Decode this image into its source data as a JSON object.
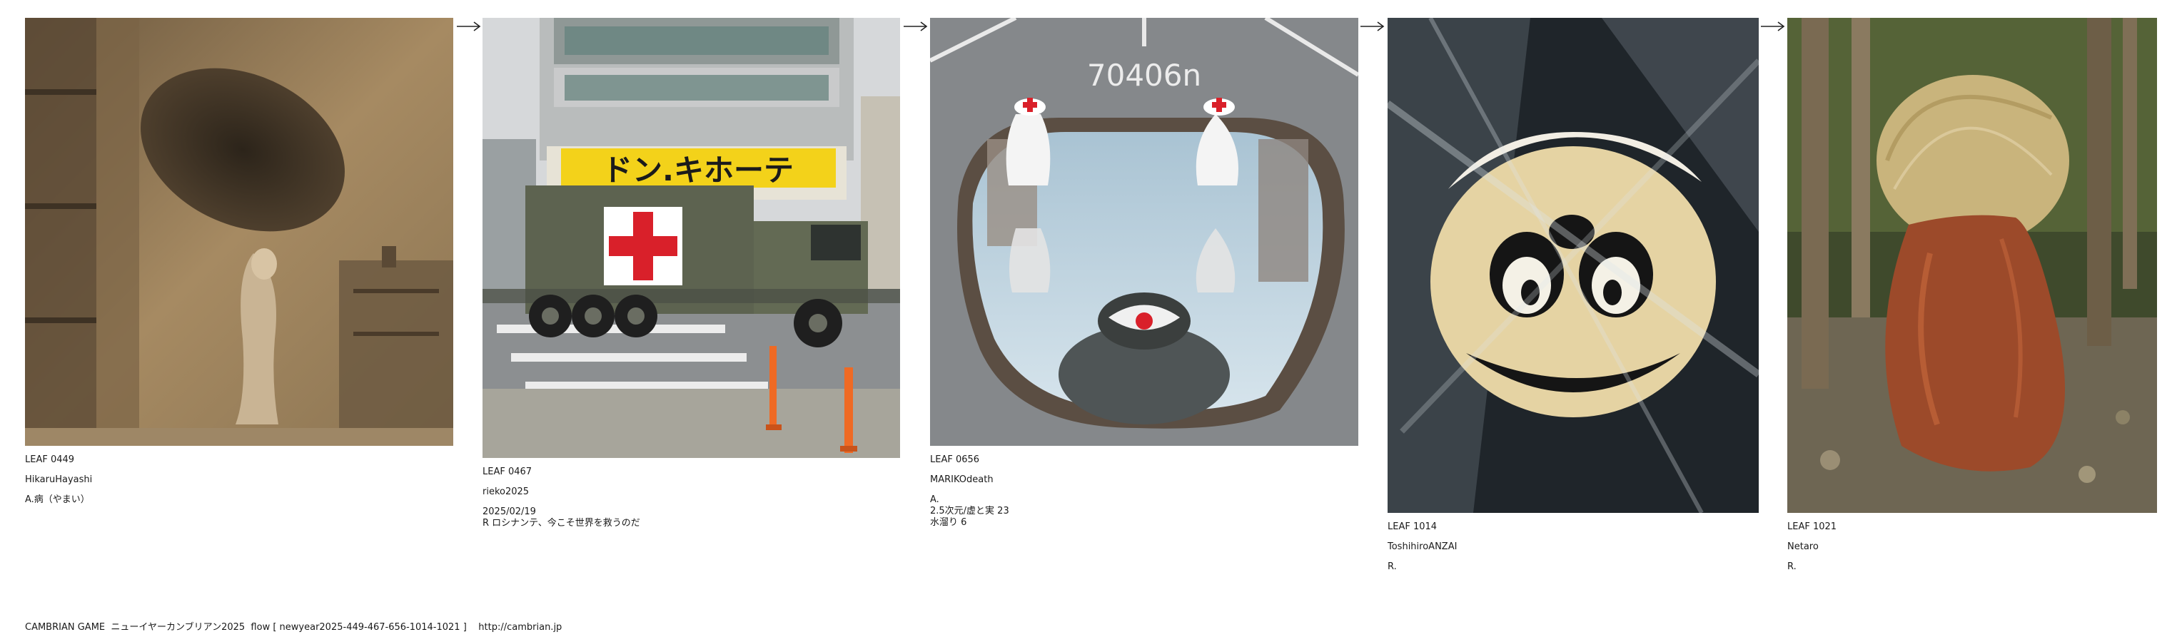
{
  "game": {
    "footer_text": "CAMBRIAN GAME  ニューイヤーカンブリアン2025  flow [ newyear2025-449-467-656-1014-1021 ]    http://cambrian.jp"
  },
  "leaves": [
    {
      "id_label": "LEAF 0449",
      "user": "HikaruHayashi",
      "lines": [
        "A.病（やまい）"
      ],
      "photo_desc": "sepia-figure-image"
    },
    {
      "id_label": "LEAF 0467",
      "user": "rieko2025",
      "lines": [
        "2025/02/19",
        "R ロシナンテ、今こそ世界を救うのだ"
      ],
      "photo_desc": "military-truck-image",
      "sign_text": "ドン.キホーテ"
    },
    {
      "id_label": "LEAF 0656",
      "user": "MARIKOdeath",
      "lines": [
        "A.",
        "2.5次元/虚と実 23",
        "水溜り 6"
      ],
      "photo_desc": "puddle-monster-image",
      "road_text": "70406n"
    },
    {
      "id_label": "LEAF 1014",
      "user": "ToshihiroANZAI",
      "lines": [
        "R."
      ],
      "photo_desc": "plastic-wrapped-face-image"
    },
    {
      "id_label": "LEAF 1021",
      "user": "Netaro",
      "lines": [
        "R."
      ],
      "photo_desc": "garbage-bag-image"
    }
  ],
  "colors": {
    "sepia": "#8a6e4b",
    "cross_red": "#d9202a",
    "truck_green": "#5d6350",
    "sign_yellow": "#f3d21a",
    "bag_brown": "#9c4a2a"
  }
}
